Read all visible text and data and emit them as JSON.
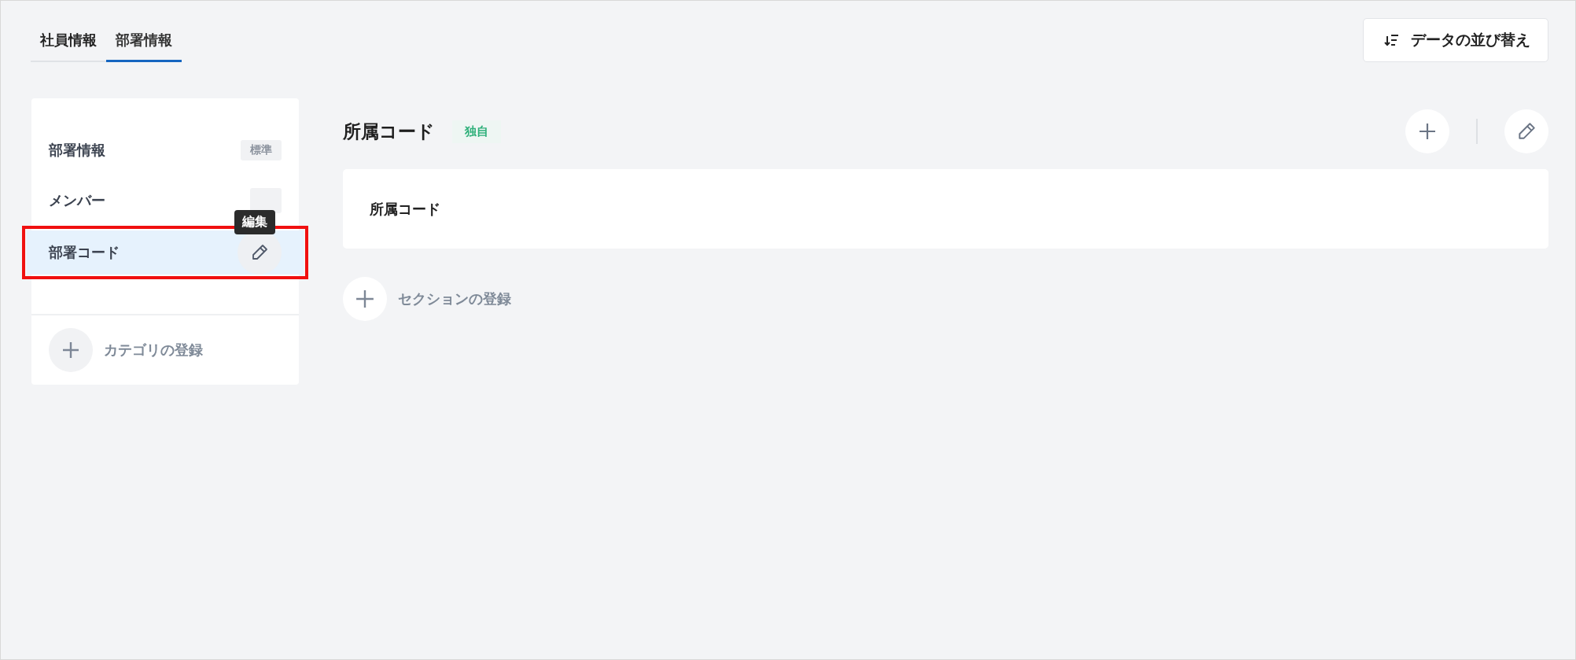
{
  "tabs": [
    {
      "label": "社員情報",
      "selected": false
    },
    {
      "label": "部署情報",
      "selected": true
    }
  ],
  "sort_button": {
    "label": "データの並び替え"
  },
  "sidebar": {
    "items": [
      {
        "label": "部署情報",
        "has_badge": true,
        "badge": "標準",
        "selected": false,
        "highlighted": false
      },
      {
        "label": "メンバー",
        "has_badge": true,
        "selected": false,
        "highlighted": false
      },
      {
        "label": "部署コード",
        "selected": true,
        "highlighted": true,
        "tooltip": "編集"
      }
    ],
    "add_label": "カテゴリの登録"
  },
  "main": {
    "title": "所属コード",
    "badge": "独自",
    "cards": [
      {
        "label": "所属コード"
      }
    ],
    "add_label": "セクションの登録"
  }
}
